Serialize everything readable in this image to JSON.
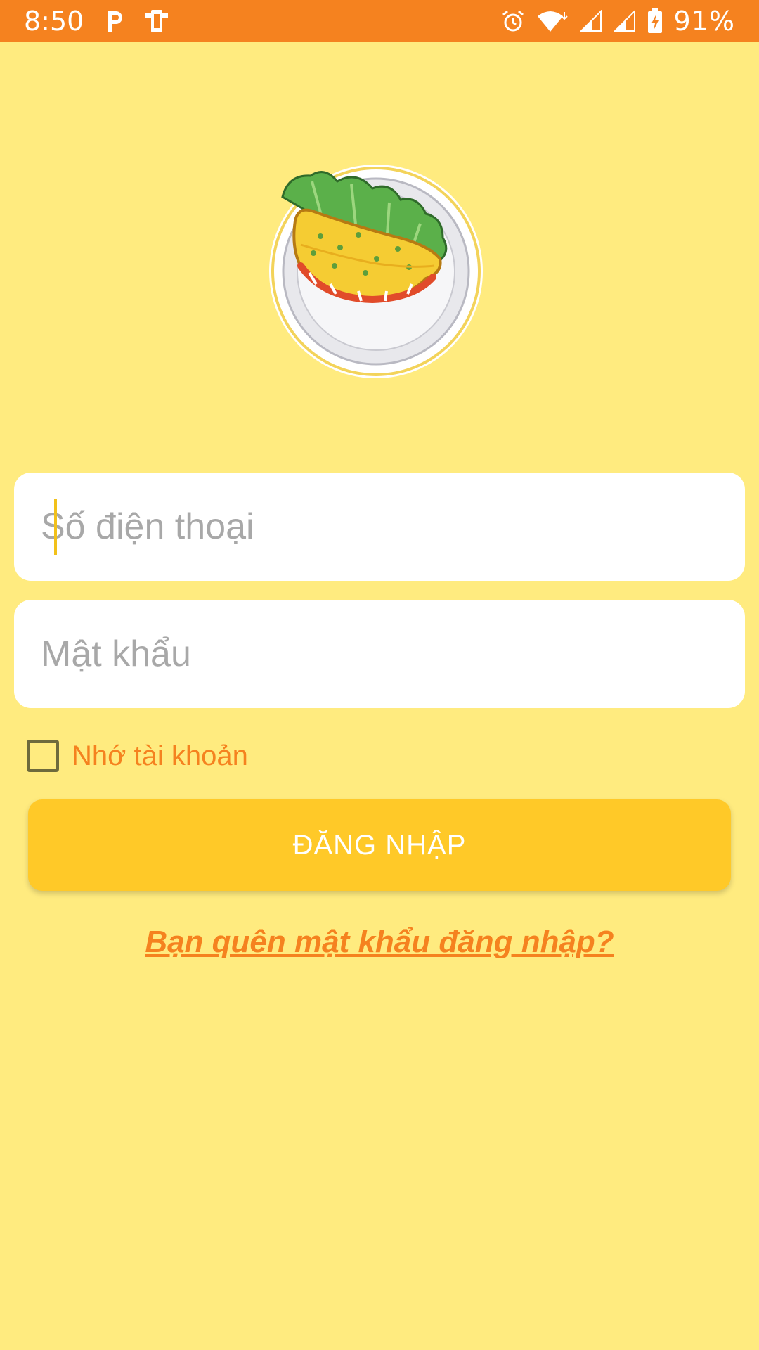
{
  "status_bar": {
    "time": "8:50",
    "battery": "91%",
    "icons": [
      "parking-icon",
      "phone-screen-icon",
      "alarm-icon",
      "wifi-icon",
      "signal-icon",
      "signal-icon",
      "battery-icon"
    ],
    "background": "#F5821F"
  },
  "logo": {
    "icon": "banh-xeo-logo-icon"
  },
  "form": {
    "phone_placeholder": "Số điện thoại",
    "password_placeholder": "Mật khẩu",
    "remember_label": "Nhớ tài khoản",
    "remember_checked": false,
    "login_button": "ĐĂNG NHẬP",
    "forgot_link": "Bạn quên mật khẩu đăng nhập?"
  },
  "colors": {
    "background": "#FFEB7F",
    "accent": "#F5821F",
    "button": "#FFC928"
  }
}
